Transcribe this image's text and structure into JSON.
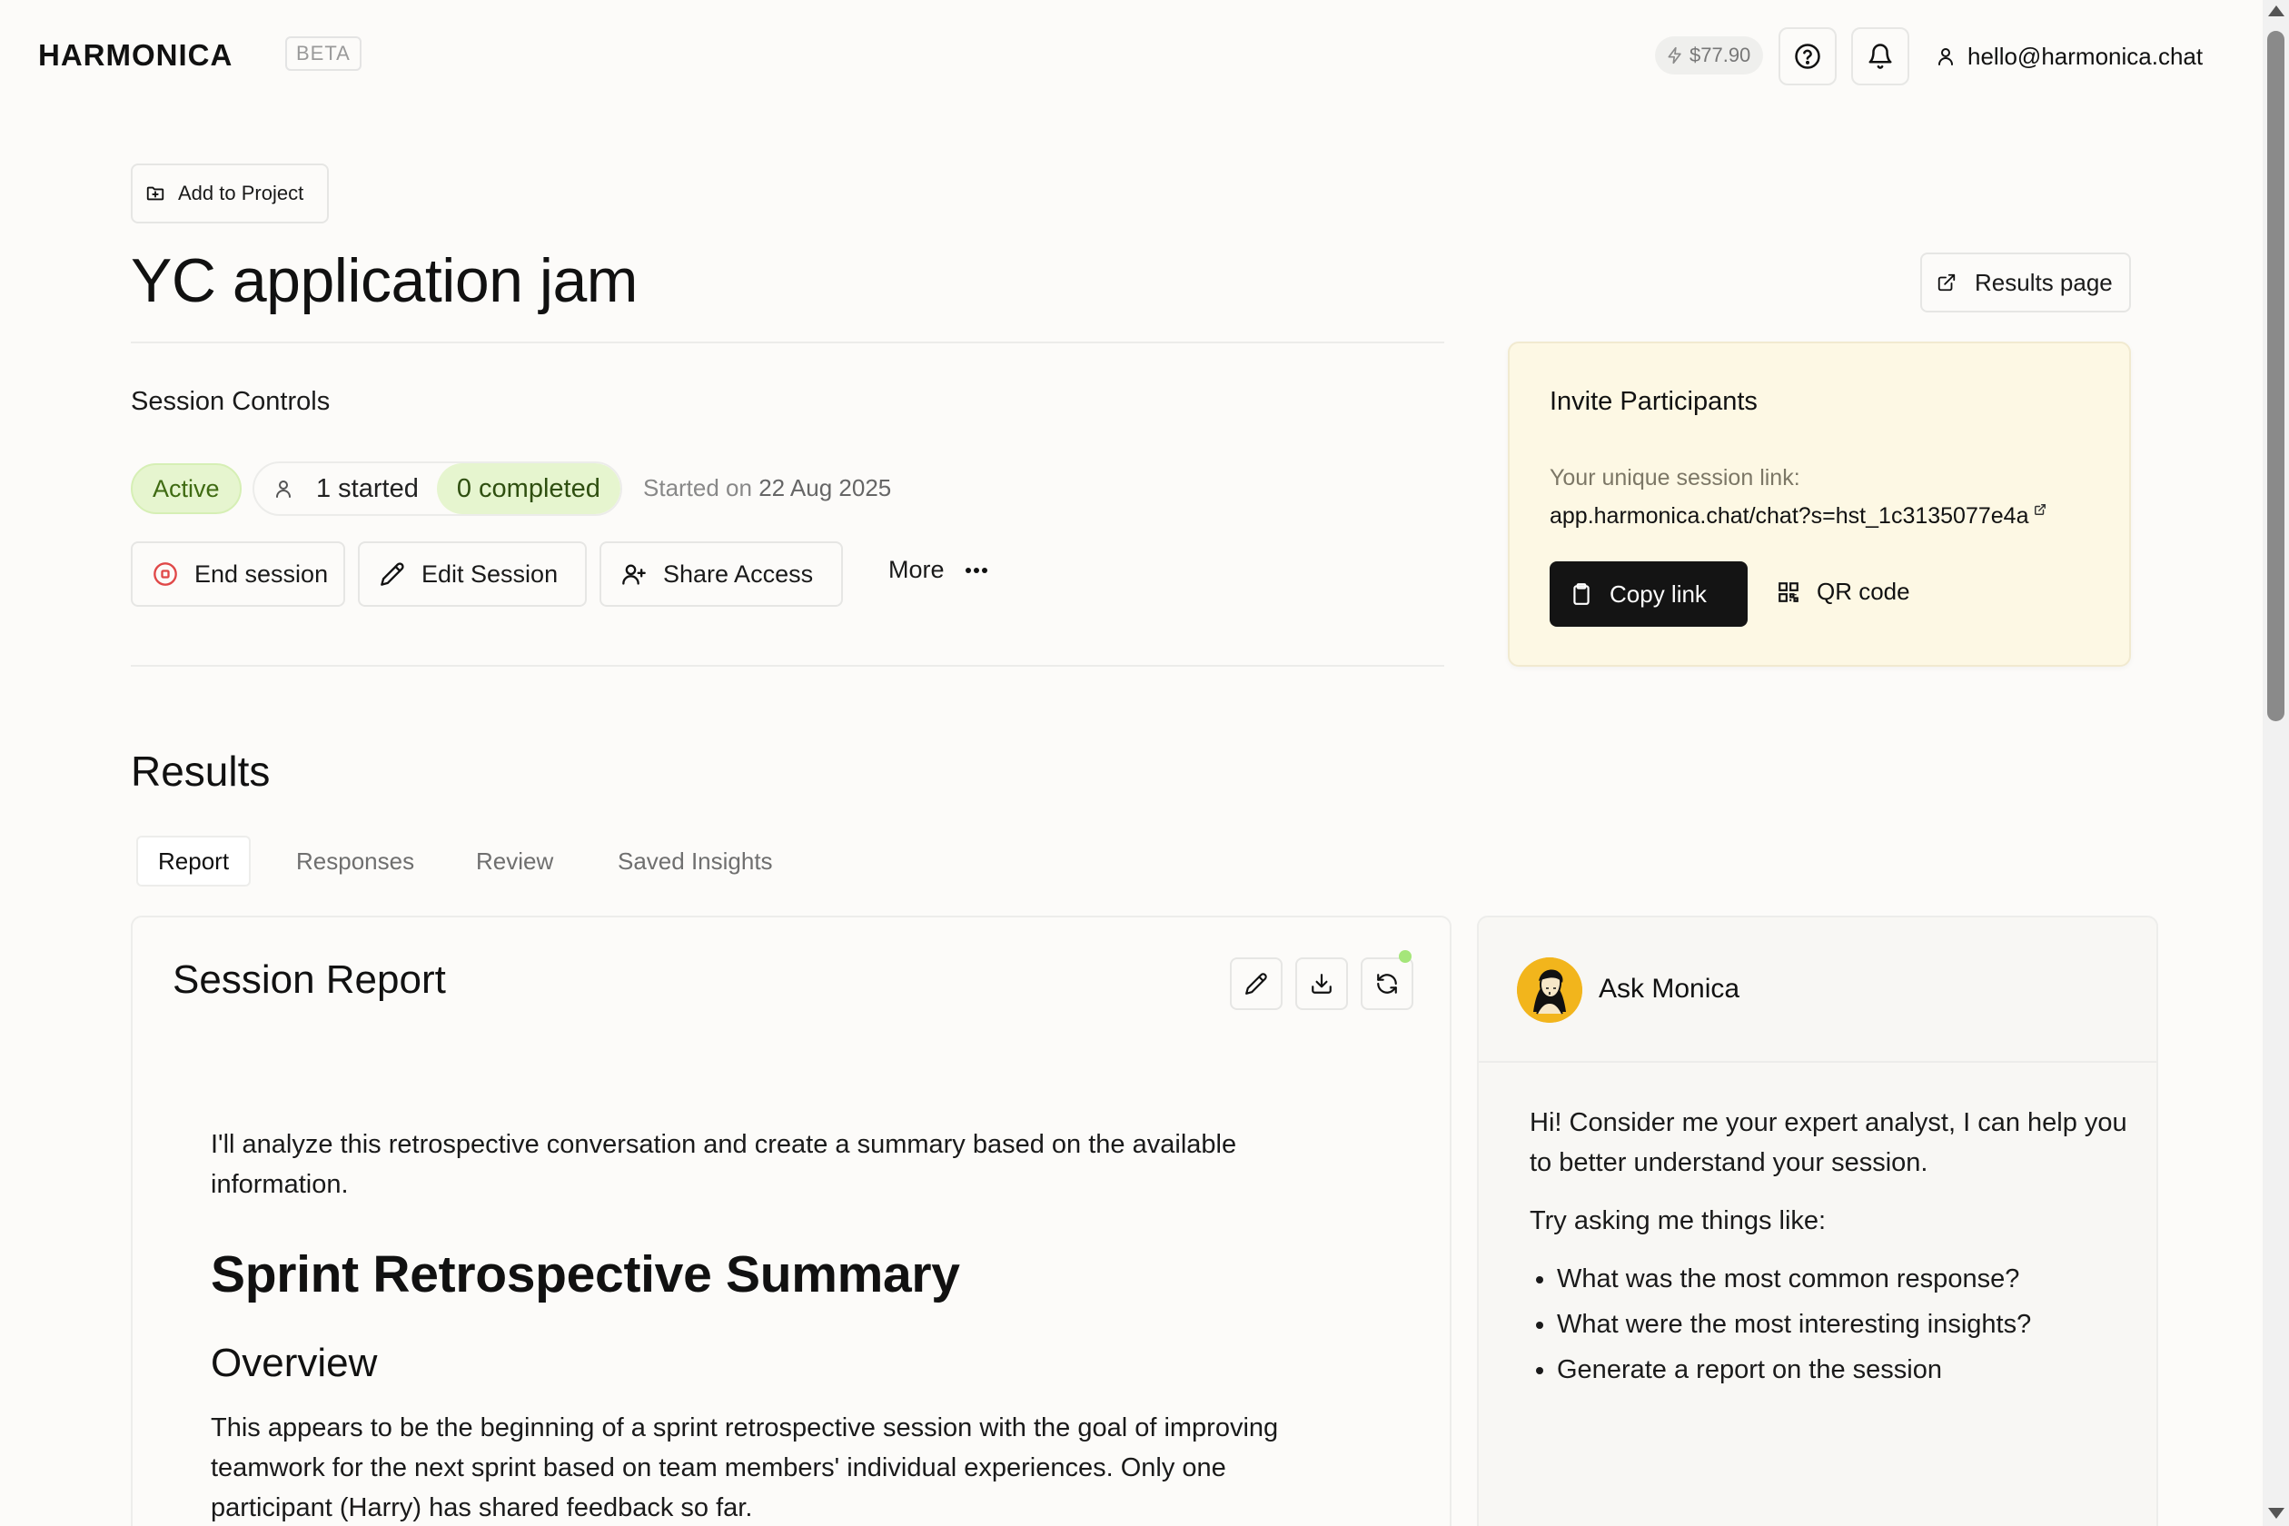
{
  "header": {
    "logo": "HARMONICA",
    "badge": "BETA",
    "credit": "$77.90",
    "user_email": "hello@harmonica.chat"
  },
  "project_button": "Add to Project",
  "session": {
    "title": "YC application jam",
    "results_page_label": "Results page",
    "controls_label": "Session Controls",
    "status": "Active",
    "started_count": "1 started",
    "completed_count": "0 completed",
    "started_on_prefix": "Started on",
    "started_on_date": "22 Aug 2025",
    "actions": {
      "end": "End session",
      "edit": "Edit Session",
      "share": "Share Access",
      "more": "More"
    }
  },
  "invite": {
    "title": "Invite Participants",
    "link_label": "Your unique session link:",
    "link": "app.harmonica.chat/chat?s=hst_1c3135077e4a",
    "copy_label": "Copy link",
    "qr_label": "QR code"
  },
  "results": {
    "heading": "Results",
    "tabs": [
      "Report",
      "Responses",
      "Review",
      "Saved Insights"
    ],
    "active_tab": "Report"
  },
  "report": {
    "title": "Session Report",
    "intro": "I'll analyze this retrospective conversation and create a summary based on the available information.",
    "h1": "Sprint Retrospective Summary",
    "h2": "Overview",
    "overview": "This appears to be the beginning of a sprint retrospective session with the goal of improving teamwork for the next sprint based on team members' individual experiences. Only one participant (Harry) has shared feedback so far."
  },
  "monica": {
    "name": "Ask Monica",
    "greeting": "Hi! Consider me your expert analyst, I can help you to better understand your session.",
    "prompt": "Try asking me things like:",
    "suggestions": [
      "What was the most common response?",
      "What were the most interesting insights?",
      "Generate a report on the session"
    ]
  },
  "colors": {
    "background": "#fcfbf9",
    "active_green_bg": "#e6f5cf",
    "invite_bg": "#fdf8e4",
    "end_red": "#e04848",
    "copy_btn": "#141414",
    "status_dot": "#a5e67a"
  }
}
